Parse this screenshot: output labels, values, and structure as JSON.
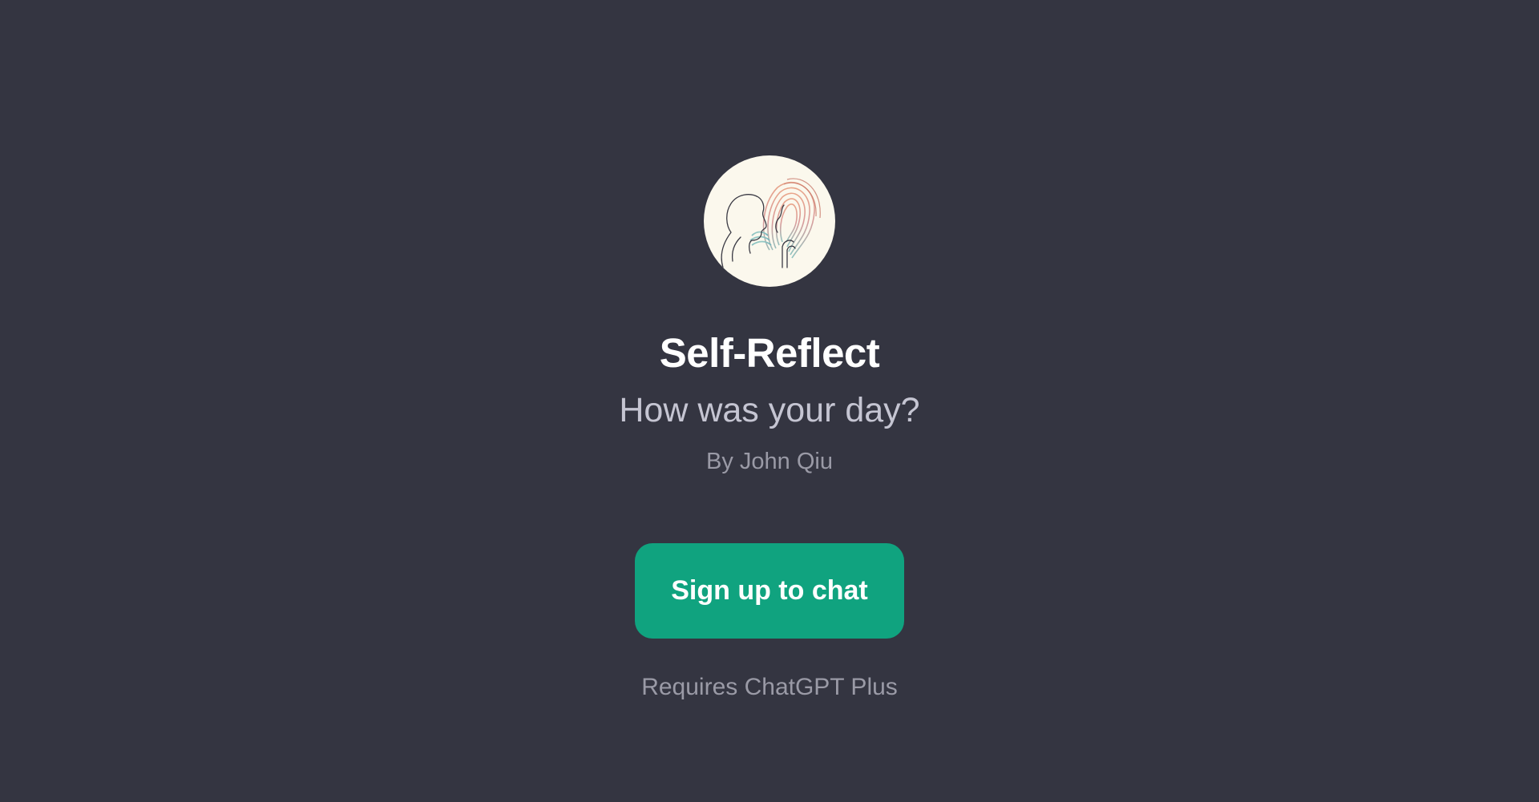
{
  "gpt": {
    "name": "Self-Reflect",
    "description": "How was your day?",
    "author": "By John Qiu",
    "avatar_icon": "self-reflect-profile-icon"
  },
  "actions": {
    "signup_label": "Sign up to chat"
  },
  "footer": {
    "requirement": "Requires ChatGPT Plus"
  },
  "colors": {
    "background": "#343541",
    "accent": "#10A37F",
    "title": "#FFFFFF",
    "subtitle": "#C5C5D2",
    "muted": "#9A9AA6",
    "avatar_background": "#FBF8ED"
  }
}
